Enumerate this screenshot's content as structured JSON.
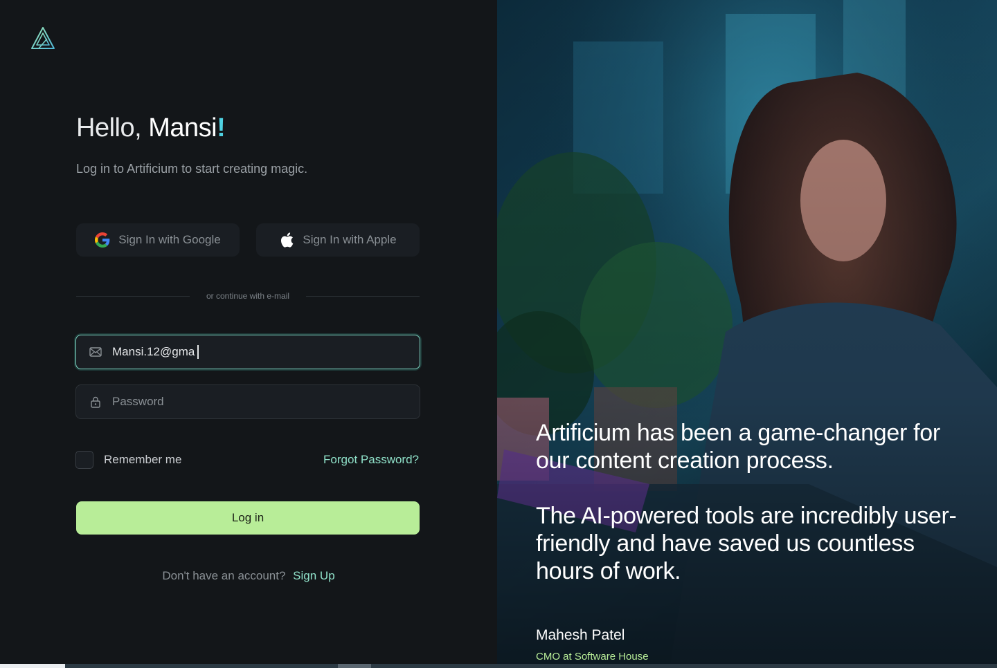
{
  "logo": {
    "icon": "artificium-logo-icon"
  },
  "greeting": {
    "hello": "Hello,",
    "name": "Mansi",
    "bang": "!"
  },
  "subtitle": "Log in to Artificium to start creating magic.",
  "social": {
    "google_label": "Sign In with Google",
    "google_icon": "google-icon",
    "apple_label": "Sign In with Apple",
    "apple_icon": "apple-icon"
  },
  "divider_text": "or continue with e-mail",
  "email": {
    "value": "Mansi.12@gma",
    "icon": "mail-icon"
  },
  "password": {
    "placeholder": "Password",
    "icon": "lock-icon"
  },
  "remember_label": "Remember me",
  "forgot_label": "Forgot Password?",
  "login_label": "Log in",
  "signup": {
    "question": "Don't have an account?",
    "link": "Sign Up"
  },
  "testimonial": {
    "line1": "Artificium has been a game-changer for our content creation process.",
    "line2": "The AI-powered tools are incredibly user-friendly and have saved us countless hours of work.",
    "author": "Mahesh Patel",
    "role": "CMO at Software House"
  },
  "colors": {
    "accent_green": "#b8ed98",
    "accent_teal": "#8fe0c8",
    "background": "#131619"
  }
}
